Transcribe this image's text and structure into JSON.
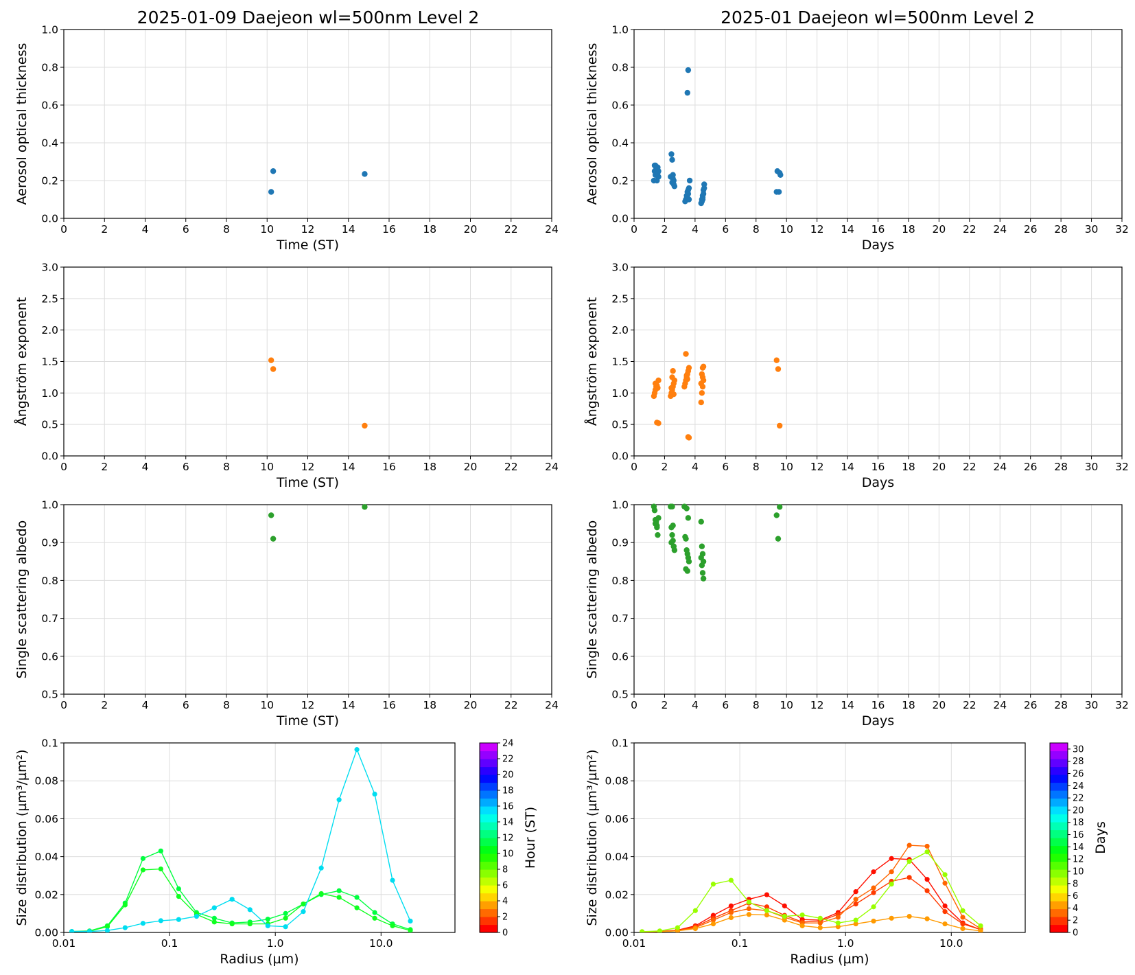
{
  "figure": {
    "left_title": "2025-01-09  Daejeon  wl=500nm  Level 2",
    "right_title": "2025-01  Daejeon  wl=500nm  Level 2"
  },
  "colors": {
    "aot": "#1f77b4",
    "ae": "#ff7f0e",
    "ssa": "#2ca02c",
    "grid": "#dddddd"
  },
  "chart_data": [
    {
      "id": "aot_day",
      "type": "scatter",
      "xlabel": "Time (ST)",
      "ylabel": "Aerosol optical thickness",
      "xlim": [
        0,
        24
      ],
      "ylim": [
        0,
        1.0
      ],
      "xticks": [
        0,
        2,
        4,
        6,
        8,
        10,
        12,
        14,
        16,
        18,
        20,
        22,
        24
      ],
      "yticks": [
        0.0,
        0.2,
        0.4,
        0.6,
        0.8,
        1.0
      ],
      "yfmt": 1,
      "grid": true,
      "color": "#1f77b4",
      "x": [
        10.2,
        10.3,
        14.8
      ],
      "y": [
        0.14,
        0.25,
        0.235
      ]
    },
    {
      "id": "aot_month",
      "type": "scatter",
      "xlabel": "Days",
      "ylabel": "Aerosol optical thickness",
      "xlim": [
        0,
        32
      ],
      "ylim": [
        0,
        1.0
      ],
      "xticks": [
        0,
        2,
        4,
        6,
        8,
        10,
        12,
        14,
        16,
        18,
        20,
        22,
        24,
        26,
        28,
        30,
        32
      ],
      "yticks": [
        0.0,
        0.2,
        0.4,
        0.6,
        0.8,
        1.0
      ],
      "yfmt": 1,
      "grid": true,
      "color": "#1f77b4",
      "x": [
        1.3,
        1.35,
        1.4,
        1.45,
        1.5,
        1.55,
        1.6,
        1.35,
        1.5,
        1.6,
        1.4,
        1.55,
        2.4,
        2.45,
        2.5,
        2.55,
        2.6,
        2.65,
        2.5,
        2.55,
        2.6,
        2.45,
        3.35,
        3.4,
        3.45,
        3.5,
        3.55,
        3.6,
        3.65,
        3.5,
        3.55,
        3.6,
        3.5,
        3.55,
        4.4,
        4.45,
        4.5,
        4.55,
        4.6,
        4.45,
        4.5,
        4.55,
        4.6,
        4.5,
        9.35,
        9.4,
        9.5,
        9.55,
        9.6
      ],
      "y": [
        0.2,
        0.25,
        0.28,
        0.27,
        0.26,
        0.24,
        0.22,
        0.28,
        0.2,
        0.25,
        0.23,
        0.27,
        0.22,
        0.34,
        0.31,
        0.23,
        0.2,
        0.17,
        0.19,
        0.21,
        0.18,
        0.22,
        0.09,
        0.1,
        0.12,
        0.14,
        0.15,
        0.16,
        0.2,
        0.11,
        0.13,
        0.1,
        0.665,
        0.785,
        0.08,
        0.1,
        0.12,
        0.15,
        0.18,
        0.09,
        0.11,
        0.13,
        0.16,
        0.1,
        0.14,
        0.25,
        0.14,
        0.24,
        0.23
      ]
    },
    {
      "id": "ae_day",
      "type": "scatter",
      "xlabel": "Time (ST)",
      "ylabel": "Ångström exponent",
      "xlim": [
        0,
        24
      ],
      "ylim": [
        0,
        3.0
      ],
      "xticks": [
        0,
        2,
        4,
        6,
        8,
        10,
        12,
        14,
        16,
        18,
        20,
        22,
        24
      ],
      "yticks": [
        0.0,
        0.5,
        1.0,
        1.5,
        2.0,
        2.5,
        3.0
      ],
      "yfmt": 1,
      "grid": true,
      "color": "#ff7f0e",
      "x": [
        10.2,
        10.3,
        14.8
      ],
      "y": [
        1.52,
        1.38,
        0.48
      ]
    },
    {
      "id": "ae_month",
      "type": "scatter",
      "xlabel": "Days",
      "ylabel": "Ångström exponent",
      "xlim": [
        0,
        32
      ],
      "ylim": [
        0,
        3.0
      ],
      "xticks": [
        0,
        2,
        4,
        6,
        8,
        10,
        12,
        14,
        16,
        18,
        20,
        22,
        24,
        26,
        28,
        30,
        32
      ],
      "yticks": [
        0.0,
        0.5,
        1.0,
        1.5,
        2.0,
        2.5,
        3.0
      ],
      "yfmt": 1,
      "grid": true,
      "color": "#ff7f0e",
      "x": [
        1.3,
        1.35,
        1.4,
        1.45,
        1.5,
        1.55,
        1.6,
        1.4,
        1.5,
        1.6,
        2.4,
        2.45,
        2.5,
        2.55,
        2.6,
        2.65,
        2.5,
        2.55,
        2.45,
        2.6,
        3.3,
        3.35,
        3.4,
        3.45,
        3.5,
        3.55,
        3.6,
        3.4,
        3.5,
        3.45,
        3.55,
        3.6,
        4.4,
        4.45,
        4.5,
        4.55,
        4.45,
        4.5,
        4.55,
        4.4,
        4.5,
        9.35,
        9.45,
        9.55
      ],
      "y": [
        0.95,
        1.0,
        1.05,
        1.1,
        1.12,
        1.08,
        1.2,
        1.15,
        0.53,
        0.52,
        0.95,
        1.0,
        1.05,
        1.1,
        1.15,
        1.2,
        1.25,
        1.35,
        1.08,
        0.98,
        1.1,
        1.15,
        1.2,
        1.25,
        1.3,
        1.35,
        1.4,
        1.62,
        1.22,
        1.28,
        0.3,
        0.29,
        0.85,
        1.0,
        1.1,
        1.2,
        1.3,
        1.4,
        1.42,
        1.15,
        1.25,
        1.52,
        1.38,
        0.48
      ]
    },
    {
      "id": "ssa_day",
      "type": "scatter",
      "xlabel": "Time (ST)",
      "ylabel": "Single scattering albedo",
      "xlim": [
        0,
        24
      ],
      "ylim": [
        0.5,
        1.0
      ],
      "xticks": [
        0,
        2,
        4,
        6,
        8,
        10,
        12,
        14,
        16,
        18,
        20,
        22,
        24
      ],
      "yticks": [
        0.5,
        0.6,
        0.7,
        0.8,
        0.9,
        1.0
      ],
      "yfmt": 1,
      "grid": true,
      "color": "#2ca02c",
      "x": [
        10.2,
        10.3,
        14.8
      ],
      "y": [
        0.972,
        0.91,
        0.994
      ]
    },
    {
      "id": "ssa_month",
      "type": "scatter",
      "xlabel": "Days",
      "ylabel": "Single scattering albedo",
      "xlim": [
        0,
        32
      ],
      "ylim": [
        0.5,
        1.0
      ],
      "xticks": [
        0,
        2,
        4,
        6,
        8,
        10,
        12,
        14,
        16,
        18,
        20,
        22,
        24,
        26,
        28,
        30,
        32
      ],
      "yticks": [
        0.5,
        0.6,
        0.7,
        0.8,
        0.9,
        1.0
      ],
      "yfmt": 1,
      "grid": true,
      "color": "#2ca02c",
      "x": [
        1.3,
        1.35,
        1.4,
        1.45,
        1.5,
        1.55,
        1.6,
        1.4,
        1.5,
        2.4,
        2.45,
        2.5,
        2.55,
        2.6,
        2.65,
        2.5,
        2.55,
        2.45,
        2.6,
        3.3,
        3.35,
        3.4,
        3.45,
        3.5,
        3.55,
        3.6,
        3.4,
        3.5,
        3.45,
        3.55,
        4.4,
        4.45,
        4.5,
        4.55,
        4.45,
        4.5,
        4.55,
        4.4,
        9.35,
        9.45,
        9.55
      ],
      "y": [
        0.995,
        0.985,
        0.96,
        0.955,
        0.945,
        0.92,
        0.965,
        0.95,
        0.94,
        0.995,
        0.94,
        0.92,
        0.905,
        0.89,
        0.88,
        0.995,
        0.945,
        0.9,
        0.89,
        0.995,
        0.915,
        0.91,
        0.88,
        0.87,
        0.86,
        0.85,
        0.83,
        0.825,
        0.99,
        0.965,
        0.955,
        0.89,
        0.87,
        0.85,
        0.84,
        0.82,
        0.805,
        0.86,
        0.972,
        0.91,
        0.994
      ]
    },
    {
      "id": "sd_day",
      "type": "line",
      "xlabel": "Radius (µm)",
      "ylabel": "Size distribution (µm³/µm²)",
      "xscale": "log",
      "xlim": [
        0.01,
        50
      ],
      "ylim": [
        0,
        0.1
      ],
      "xticks": [
        0.01,
        0.1,
        1.0,
        10.0
      ],
      "xticklabels": [
        "0.01",
        "0.1",
        "1.0",
        "10.0"
      ],
      "yticks": [
        0.0,
        0.02,
        0.04,
        0.06,
        0.08,
        0.1
      ],
      "ytickfmt": "auto",
      "grid": true,
      "x": [
        0.0119,
        0.0175,
        0.0258,
        0.038,
        0.0561,
        0.0827,
        0.122,
        0.18,
        0.265,
        0.39,
        0.576,
        0.85,
        1.25,
        1.84,
        2.72,
        4.01,
        5.91,
        8.71,
        12.84,
        18.93
      ],
      "colorbar": {
        "label": "Hour (ST)",
        "min": 0,
        "max": 24,
        "ticks": [
          0,
          2,
          4,
          6,
          8,
          10,
          12,
          14,
          16,
          18,
          20,
          22,
          24
        ]
      },
      "series": [
        {
          "c": 10.2,
          "color": "#00ff40",
          "values": [
            0.0005,
            0.0008,
            0.0035,
            0.0155,
            0.039,
            0.043,
            0.023,
            0.0105,
            0.0075,
            0.005,
            0.0055,
            0.007,
            0.01,
            0.015,
            0.02,
            0.022,
            0.0185,
            0.0105,
            0.0045,
            0.0015
          ]
        },
        {
          "c": 10.3,
          "color": "#10ff20",
          "values": [
            0.0004,
            0.0007,
            0.003,
            0.0145,
            0.033,
            0.0335,
            0.019,
            0.0095,
            0.0055,
            0.0045,
            0.0045,
            0.0045,
            0.0075,
            0.015,
            0.0205,
            0.0185,
            0.013,
            0.0075,
            0.0035,
            0.001
          ]
        },
        {
          "c": 14.8,
          "color": "#00ddf0",
          "values": [
            0.0005,
            0.0005,
            0.001,
            0.0025,
            0.0048,
            0.0062,
            0.0068,
            0.0085,
            0.013,
            0.0175,
            0.012,
            0.0035,
            0.003,
            0.011,
            0.034,
            0.07,
            0.0965,
            0.073,
            0.0275,
            0.006
          ]
        }
      ]
    },
    {
      "id": "sd_month",
      "type": "line",
      "xlabel": "Radius (µm)",
      "ylabel": "Size distribution (µm³/µm²)",
      "xscale": "log",
      "xlim": [
        0.01,
        50
      ],
      "ylim": [
        0,
        0.1
      ],
      "xticks": [
        0.01,
        0.1,
        1.0,
        10.0
      ],
      "xticklabels": [
        "0.01",
        "0.1",
        "1.0",
        "10.0"
      ],
      "yticks": [
        0.0,
        0.02,
        0.04,
        0.06,
        0.08,
        0.1
      ],
      "ytickfmt": "auto",
      "grid": true,
      "x": [
        0.0119,
        0.0175,
        0.0258,
        0.038,
        0.0561,
        0.0827,
        0.122,
        0.18,
        0.265,
        0.39,
        0.576,
        0.85,
        1.25,
        1.84,
        2.72,
        4.01,
        5.91,
        8.71,
        12.84,
        18.93
      ],
      "colorbar": {
        "label": "Days",
        "min": 0,
        "max": 31,
        "ticks": [
          0,
          2,
          4,
          6,
          8,
          10,
          12,
          14,
          16,
          18,
          20,
          22,
          24,
          26,
          28,
          30
        ]
      },
      "series": [
        {
          "c": 1.5,
          "color": "#ff0f00",
          "values": [
            0.0003,
            0.0005,
            0.0012,
            0.0035,
            0.009,
            0.014,
            0.0175,
            0.0199,
            0.014,
            0.0068,
            0.0065,
            0.0105,
            0.0215,
            0.032,
            0.039,
            0.0385,
            0.028,
            0.014,
            0.005,
            0.0015
          ]
        },
        {
          "c": 2.5,
          "color": "#ff3a00",
          "values": [
            0.0003,
            0.0005,
            0.001,
            0.003,
            0.0075,
            0.0115,
            0.0155,
            0.0135,
            0.009,
            0.0055,
            0.006,
            0.0095,
            0.015,
            0.021,
            0.027,
            0.029,
            0.022,
            0.011,
            0.0045,
            0.0015
          ]
        },
        {
          "c": 3.5,
          "color": "#ff6500",
          "values": [
            0.0003,
            0.0005,
            0.0009,
            0.0025,
            0.0065,
            0.0105,
            0.0125,
            0.0115,
            0.008,
            0.005,
            0.005,
            0.008,
            0.0175,
            0.0235,
            0.032,
            0.046,
            0.0455,
            0.026,
            0.008,
            0.002
          ]
        },
        {
          "c": 4.5,
          "color": "#ff9a00",
          "values": [
            0.0003,
            0.0004,
            0.0008,
            0.002,
            0.0045,
            0.0078,
            0.0095,
            0.0092,
            0.0065,
            0.0035,
            0.0025,
            0.003,
            0.0045,
            0.006,
            0.0075,
            0.0085,
            0.0072,
            0.0045,
            0.002,
            0.0008
          ]
        },
        {
          "c": 9.5,
          "color": "#99ff00",
          "values": [
            0.0004,
            0.0008,
            0.0025,
            0.0115,
            0.0255,
            0.0275,
            0.016,
            0.0115,
            0.0085,
            0.0092,
            0.0075,
            0.005,
            0.0065,
            0.0135,
            0.0255,
            0.0375,
            0.0425,
            0.0305,
            0.0115,
            0.0035
          ]
        }
      ]
    }
  ]
}
